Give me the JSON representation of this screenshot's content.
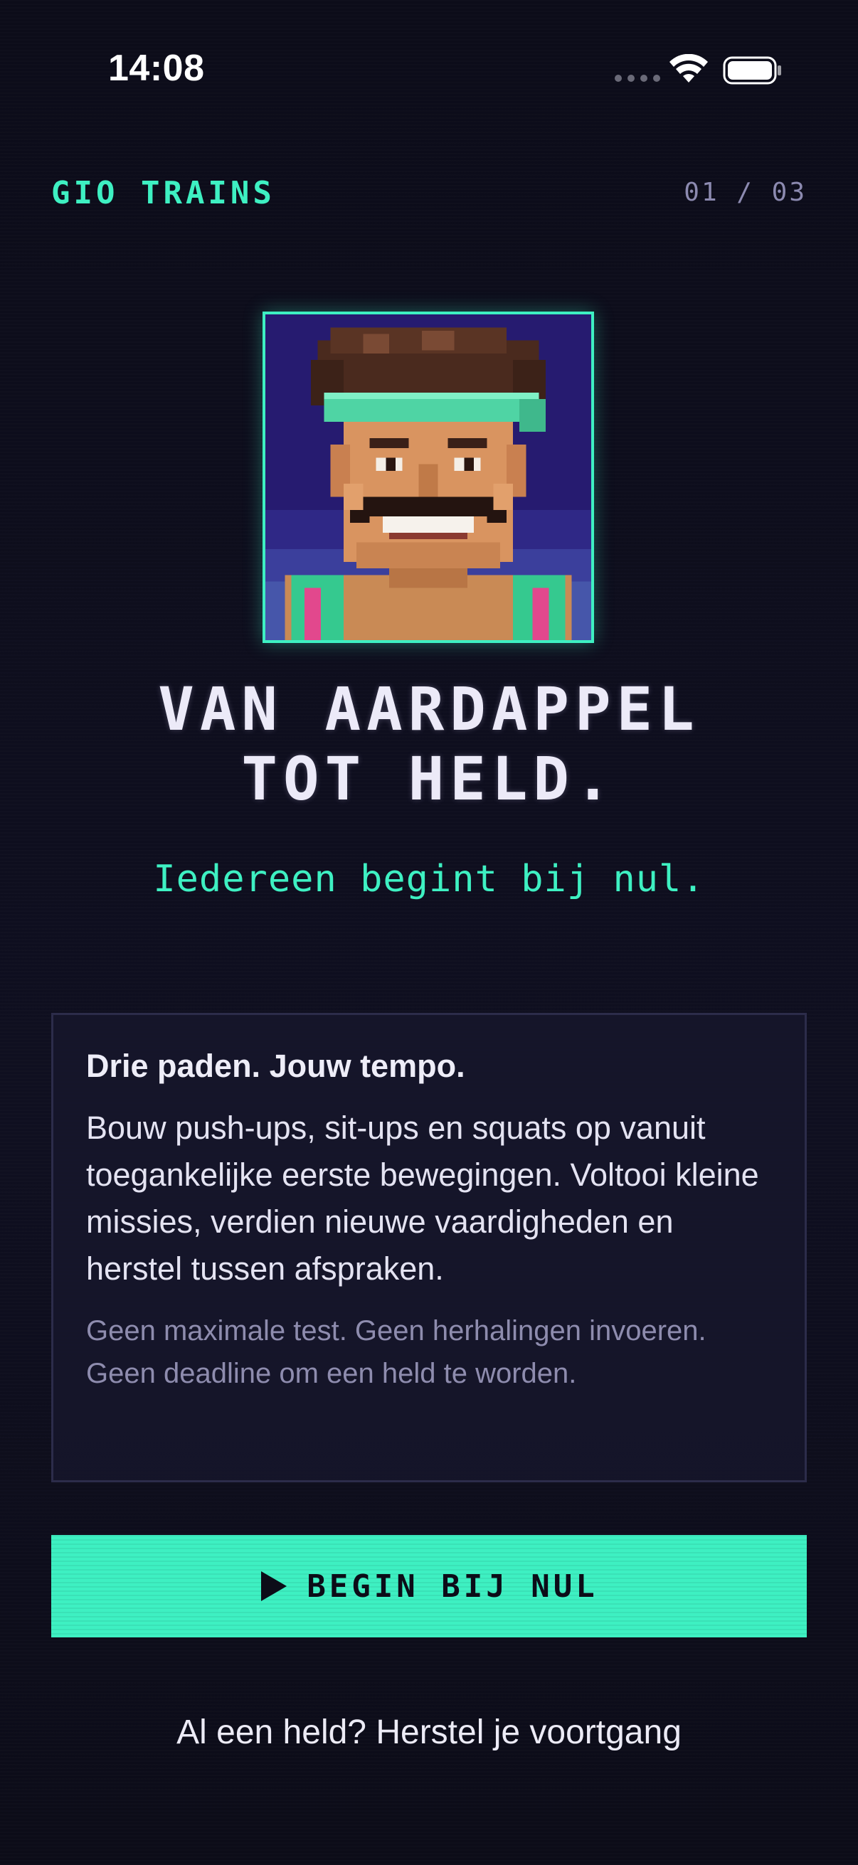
{
  "status_bar": {
    "time": "14:08"
  },
  "header": {
    "brand": "GIO TRAINS",
    "step": "01 / 03"
  },
  "hero": {
    "avatar": "pixel-art-trainer-portrait",
    "headline_line1": "VAN AARDAPPEL",
    "headline_line2": "TOT HELD.",
    "tagline": "Iedereen begint bij nul."
  },
  "card": {
    "title": "Drie paden. Jouw tempo.",
    "body": "Bouw push-ups, sit-ups en squats op vanuit toegankelijke eerste bewegingen. Voltooi kleine missies, verdien nieuwe vaardigheden en herstel tussen afspraken.",
    "note": "Geen maximale test. Geen herhalingen invoeren. Geen deadline om een held te worden."
  },
  "cta": {
    "label": "BEGIN BIJ NUL",
    "icon": "play-icon"
  },
  "restore_link": "Al een held? Herstel je voortgang",
  "colors": {
    "background": "#0d0d1a",
    "accent": "#3ef0c2",
    "muted": "#8c8ab0",
    "text": "#eceaf8"
  }
}
